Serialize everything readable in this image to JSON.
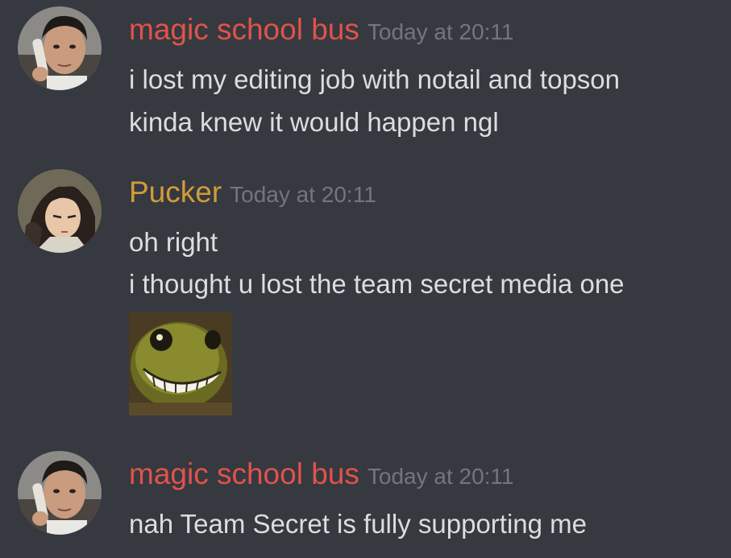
{
  "colors": {
    "background": "#36393f",
    "message_text": "#dcddde",
    "timestamp": "#72767d",
    "magic_school_bus": "#e0534b",
    "pucker": "#d39b3a"
  },
  "messages": [
    {
      "author": "magic school bus",
      "timestamp": "Today at 20:11",
      "avatar_icon": "man-on-phone-avatar",
      "lines": [
        "i lost my editing job with notail and topson",
        "kinda knew it would happen ngl"
      ]
    },
    {
      "author": "Pucker",
      "timestamp": "Today at 20:11",
      "avatar_icon": "anime-girl-avatar",
      "lines": [
        "oh right",
        "i thought u lost the team secret media one"
      ],
      "emoji": "grinning-frog-emoji"
    },
    {
      "author": "magic school bus",
      "timestamp": "Today at 20:11",
      "avatar_icon": "man-on-phone-avatar",
      "lines": [
        "nah Team Secret is fully supporting me"
      ]
    }
  ]
}
